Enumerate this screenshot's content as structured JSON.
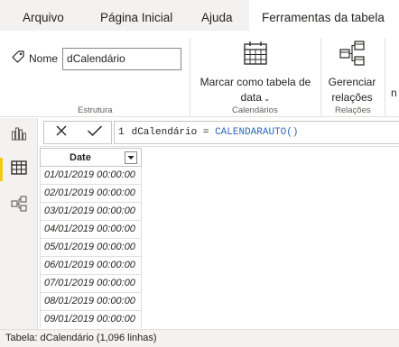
{
  "menu": {
    "tabs": [
      "Arquivo",
      "Página Inicial",
      "Ajuda",
      "Ferramentas da tabela"
    ],
    "active_tab": "Ferramentas da tabela"
  },
  "ribbon": {
    "structure": {
      "name_label": "Nome",
      "name_value": "dCalendário",
      "group_label": "Estrutura"
    },
    "calendars": {
      "mark_line1": "Marcar como tabela de",
      "mark_line2": "data",
      "group_label": "Calendários"
    },
    "relations": {
      "manage_line1": "Gerenciar",
      "manage_line2": "relações",
      "group_label": "Relações"
    },
    "cut_text": "n"
  },
  "sidebar": {
    "items": [
      {
        "name": "report-view",
        "icon": "bar-chart-icon"
      },
      {
        "name": "data-view",
        "icon": "table-icon",
        "active": true
      },
      {
        "name": "model-view",
        "icon": "model-icon"
      }
    ]
  },
  "formula": {
    "line_number": "1",
    "table_name": "dCalendário",
    "operator": "=",
    "function": "CALENDARAUTO()"
  },
  "table": {
    "column": "Date",
    "rows": [
      "01/01/2019 00:00:00",
      "02/01/2019 00:00:00",
      "03/01/2019 00:00:00",
      "04/01/2019 00:00:00",
      "05/01/2019 00:00:00",
      "06/01/2019 00:00:00",
      "07/01/2019 00:00:00",
      "08/01/2019 00:00:00",
      "09/01/2019 00:00:00"
    ]
  },
  "status": {
    "text": "Tabela: dCalendário (1,096 linhas)"
  },
  "colors": {
    "accent": "#f2c811",
    "function": "#3165bb"
  }
}
